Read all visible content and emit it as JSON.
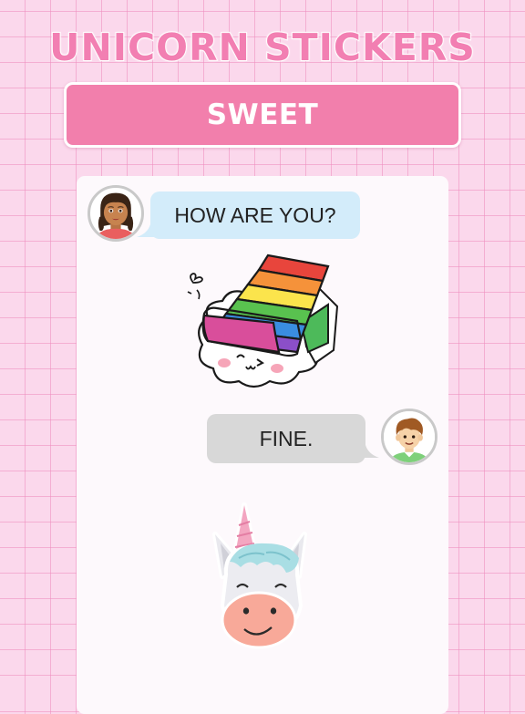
{
  "header": {
    "title": "UNICORN STICKERS",
    "category_label": "SWEET"
  },
  "chat": {
    "messages": [
      {
        "side": "incoming",
        "text": "HOW ARE YOU?",
        "avatar": "girl-avatar-icon"
      },
      {
        "side": "incoming",
        "sticker": "rainbow-sushi-sticker"
      },
      {
        "side": "outgoing",
        "text": "FINE.",
        "avatar": "boy-avatar-icon"
      },
      {
        "side": "outgoing",
        "sticker": "unicorn-face-sticker"
      }
    ]
  },
  "colors": {
    "background": "#fbd8ec",
    "grid_line": "#ee8cbe",
    "title": "#f27fb2",
    "banner": "#f27fac",
    "incoming_bubble": "#d3ecfa",
    "outgoing_bubble": "#d8d8d8",
    "card": "#fdf9fc"
  }
}
